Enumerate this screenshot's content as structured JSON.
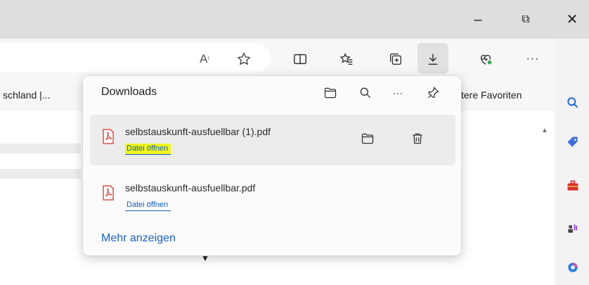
{
  "window": {
    "minimize_glyph": "–",
    "restore_glyph": "⧉",
    "close_glyph": "✕"
  },
  "toolbar": {
    "icons": [
      "read-aloud-icon",
      "favorite-star-icon",
      "split-screen-icon",
      "favorites-icon",
      "collections-icon",
      "downloads-icon",
      "browser-essentials-icon",
      "more-icon",
      "copilot-icon"
    ],
    "read_aloud_glyph": "A",
    "read_aloud_sup": "⁾",
    "more_glyph": "···"
  },
  "favorites_bar": {
    "left_item": "schland |...",
    "right_item": "tere Favoriten"
  },
  "downloads": {
    "title": "Downloads",
    "header_icons": [
      "open-folder-icon",
      "search-icon",
      "more-icon",
      "pin-icon"
    ],
    "more_glyph": "···",
    "items": [
      {
        "filename": "selbstauskunft-ausfuellbar (1).pdf",
        "action": "Datei öffnen",
        "highlighted": true
      },
      {
        "filename": "selbstauskunft-ausfuellbar.pdf",
        "action": "Datei öffnen",
        "highlighted": false
      }
    ],
    "show_more": "Mehr anzeigen"
  },
  "colors": {
    "link": "#0f5fbd",
    "highlight": "#f2f51d",
    "pdf_red": "#d9342b"
  }
}
